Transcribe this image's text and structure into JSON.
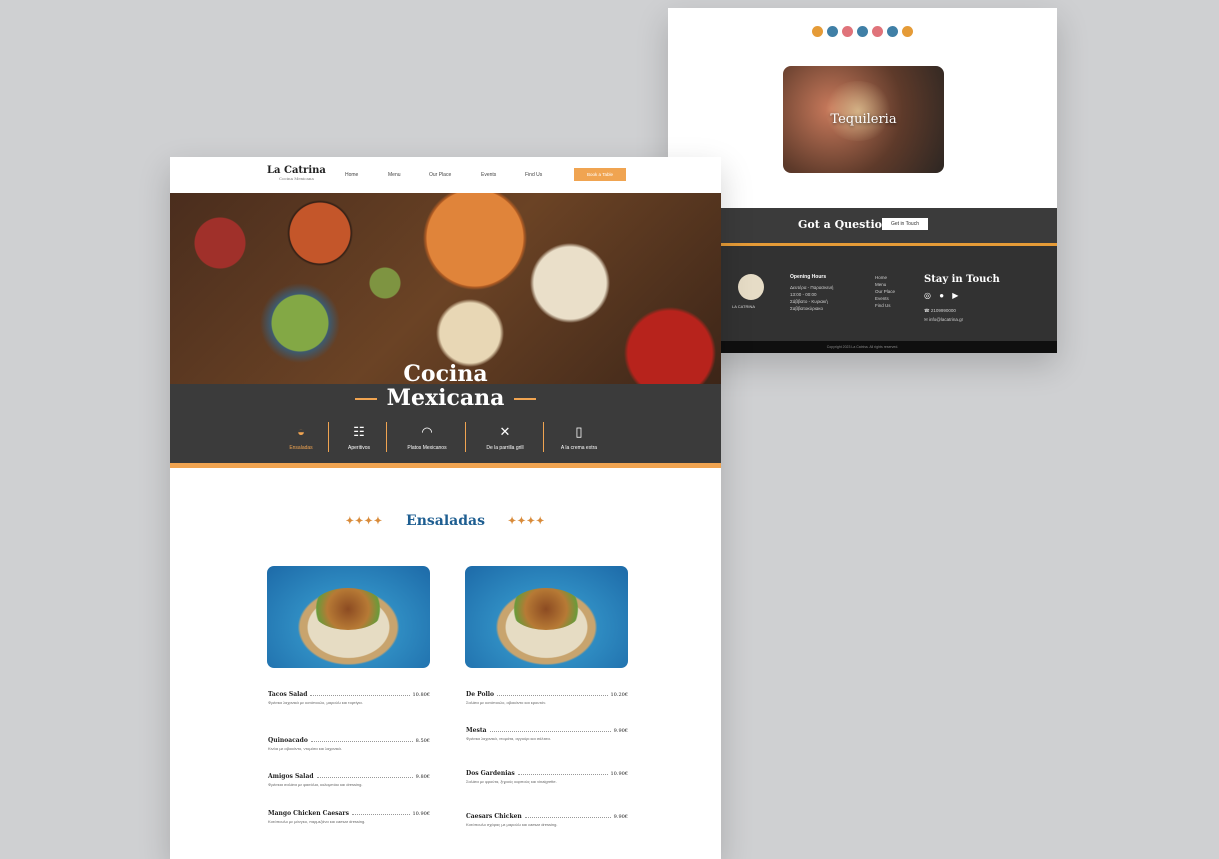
{
  "back": {
    "teq_label": "Tequileria",
    "question": "Got a Question?",
    "question_btn": "Get in Touch",
    "opening_title": "Opening Hours",
    "opening_lines": [
      "Δευτέρα - Παρασκευή",
      "13:00 - 00:00",
      "Σάββατο - Κυριακή",
      "Σαββατοκύριακο"
    ],
    "links": [
      "Home",
      "Menu",
      "Our Place",
      "Events",
      "Find Us"
    ],
    "stay": "Stay in Touch",
    "socials": "◎ ● ▶",
    "contact": [
      "☎ 2109990000",
      "✉ info@lacatrina.gr"
    ],
    "logo_text": "LA CATRINA",
    "copyright": "Copyright 2023 La Catrina. All rights reserved."
  },
  "front": {
    "brand": "La Catrina",
    "brand_sub": "Cocina Mexicana",
    "nav": [
      "Home",
      "Menu",
      "Our Place",
      "Events",
      "Find Us"
    ],
    "nav_btn": "Book a Table",
    "title_line1": "Cocina",
    "title_line2": "Mexicana",
    "categories": [
      "Ensaladas",
      "Aperitivos",
      "Platos Mexicanos",
      "De la parrilla grill",
      "A la crema extra"
    ],
    "section": "Ensaladas",
    "stars": "✦✦✦✦",
    "items_left": [
      {
        "name": "Tacos Salad",
        "price": "10.80€",
        "desc": "Φρέσκα λαχανικά με κοτόπουλο, μαρούλι και τορτίγια."
      },
      {
        "name": "Quinoacado",
        "price": "8.50€",
        "desc": "Κινόα με αβοκάντο, ντομάτα και λαχανικά."
      },
      {
        "name": "Amigos Salad",
        "price": "9.80€",
        "desc": "Φρέσκια σαλάτα με φασόλια, καλαμπόκι και dressing."
      },
      {
        "name": "Mango Chicken Caesars",
        "price": "10.90€",
        "desc": "Κοτόπουλο με μάνγκο, παρμεζάνα και caesar dressing."
      }
    ],
    "items_right": [
      {
        "name": "De Pollo",
        "price": "10.20€",
        "desc": "Σαλάτα με κοτόπουλο, αβοκάντο και κρουτόν."
      },
      {
        "name": "Mesta",
        "price": "9.90€",
        "desc": "Φρέσκα λαχανικά, ντομάτα, αγγούρι και σάλτσα."
      },
      {
        "name": "Dos Gardenias",
        "price": "10.90€",
        "desc": "Σαλάτα με φρούτα, ξηρούς καρπούς και vinaigrette."
      },
      {
        "name": "Caesars Chicken",
        "price": "9.90€",
        "desc": "Κοτόπουλο σχάρας με μαρούλι και caesar dressing."
      }
    ]
  }
}
